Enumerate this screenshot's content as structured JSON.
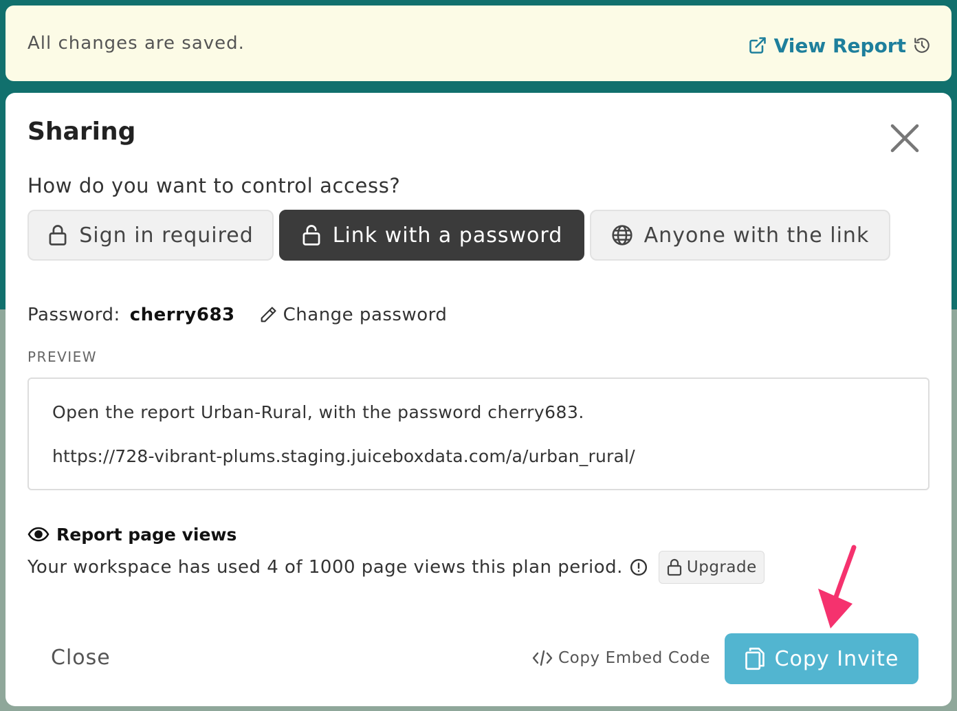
{
  "notice": {
    "message": "All changes are saved.",
    "view_report_label": "View Report"
  },
  "modal": {
    "title": "Sharing",
    "question": "How do you want to control access?",
    "access_options": [
      {
        "label": "Sign in required",
        "icon": "lock-icon",
        "selected": false
      },
      {
        "label": "Link with a password",
        "icon": "unlock-icon",
        "selected": true
      },
      {
        "label": "Anyone with the link",
        "icon": "globe-icon",
        "selected": false
      }
    ],
    "password_label": "Password:",
    "password_value": "cherry683",
    "change_password_label": "Change password",
    "preview_label": "PREVIEW",
    "preview_line1": "Open the report Urban-Rural, with the password cherry683.",
    "preview_line2": "https://728-vibrant-plums.staging.juiceboxdata.com/a/urban_rural/",
    "views_title": "Report page views",
    "views_text": "Your workspace has used 4 of 1000 page views this plan period.",
    "upgrade_label": "Upgrade",
    "close_label": "Close",
    "embed_label": "Copy Embed Code",
    "invite_label": "Copy Invite"
  },
  "colors": {
    "background_teal": "#11706d",
    "notice_bg": "#fcfbe6",
    "link_blue": "#1e7f9c",
    "selected_button": "#3b3b3b",
    "invite_button": "#52b5d0",
    "annotation_arrow": "#f5326e"
  }
}
